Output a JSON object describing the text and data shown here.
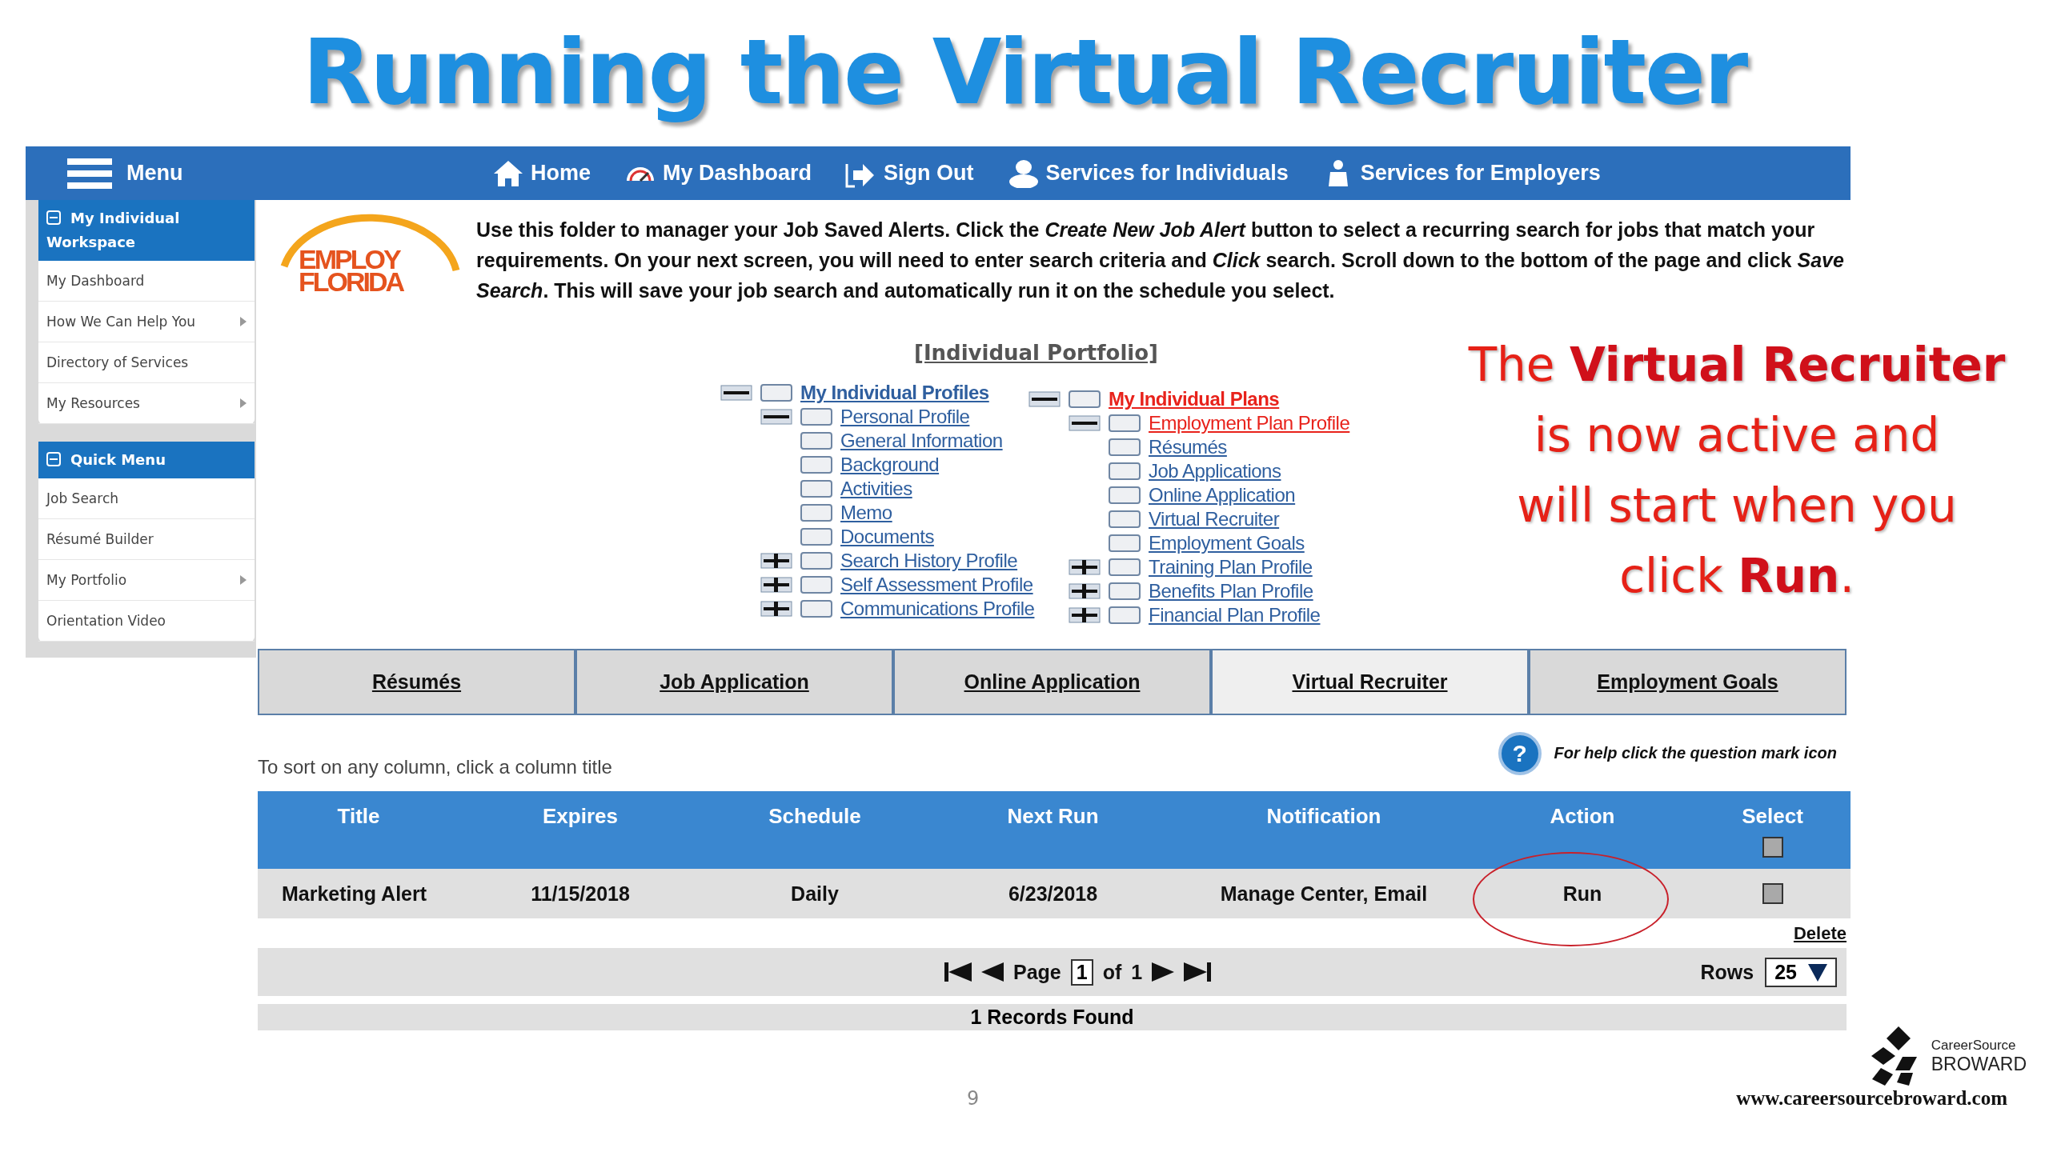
{
  "slide": {
    "title": "Running the Virtual Recruiter",
    "page_number": "9",
    "footer_url": "www.careersourcebroward.com",
    "brand": {
      "line_1": "CareerSource",
      "line_2": "BROWARD"
    }
  },
  "callout": {
    "lines": [
      "The **Virtual Recruiter**",
      "is now active and",
      "will start when you",
      "click **Run**."
    ]
  },
  "nav": {
    "menu_label": "Menu",
    "items": [
      {
        "label": "Home",
        "kind": "home"
      },
      {
        "label": "My Dashboard",
        "kind": "gauge"
      },
      {
        "label": "Sign Out",
        "kind": "signout"
      },
      {
        "label": "Services for Individuals",
        "kind": "individuals"
      },
      {
        "label": "Services for Employers",
        "kind": "employers"
      }
    ]
  },
  "sidebar": {
    "sections": [
      {
        "title": "My Individual Workspace",
        "expanded": true,
        "items": [
          {
            "label": "My Dashboard",
            "has_submenu": false
          },
          {
            "label": "How We Can Help You",
            "has_submenu": true
          },
          {
            "label": "Directory of Services",
            "has_submenu": false
          },
          {
            "label": "My Resources",
            "has_submenu": true
          }
        ]
      },
      {
        "title": "Quick Menu",
        "expanded": true,
        "items": [
          {
            "label": "Job Search",
            "has_submenu": false
          },
          {
            "label": "Résumé Builder",
            "has_submenu": false
          },
          {
            "label": "My Portfolio",
            "has_submenu": true
          },
          {
            "label": "Orientation Video",
            "has_submenu": false
          }
        ]
      }
    ]
  },
  "logo": {
    "line_1": "EMPLOY",
    "line_2": "FLORIDA"
  },
  "intro": "Use this folder to manager your Job Saved Alerts. Click the *Create New Job Alert* button to select a recurring search for jobs that match your requirements. On your next screen, you will need to enter search criteria and *Click* search. Scroll down to the bottom of the page and click *Save Search*. This will save your job search and automatically run it on the schedule you select.",
  "portfolio": {
    "title": "[Individual Portfolio]",
    "trees": [
      {
        "label": "My Individual Profiles",
        "selected": false,
        "expanded": true,
        "children": [
          {
            "label": "Personal Profile",
            "selected": false,
            "expanded": true,
            "children": [
              {
                "label": "General Information",
                "selected": false
              },
              {
                "label": "Background",
                "selected": false
              },
              {
                "label": "Activities",
                "selected": false
              },
              {
                "label": "Memo",
                "selected": false
              },
              {
                "label": "Documents",
                "selected": false
              }
            ]
          },
          {
            "label": "Search History Profile",
            "selected": false,
            "expanded": false
          },
          {
            "label": "Self Assessment Profile",
            "selected": false,
            "expanded": false
          },
          {
            "label": "Communications Profile",
            "selected": false,
            "expanded": false
          }
        ]
      },
      {
        "label": "My Individual Plans",
        "selected": true,
        "expanded": true,
        "children": [
          {
            "label": "Employment Plan Profile",
            "selected": true,
            "expanded": true,
            "children": [
              {
                "label": "Résumés",
                "selected": false
              },
              {
                "label": "Job Applications",
                "selected": false
              },
              {
                "label": "Online Application",
                "selected": false
              },
              {
                "label": "Virtual Recruiter",
                "selected": false
              },
              {
                "label": "Employment Goals",
                "selected": false
              }
            ]
          },
          {
            "label": "Training Plan Profile",
            "selected": false,
            "expanded": false
          },
          {
            "label": "Benefits Plan Profile",
            "selected": false,
            "expanded": false
          },
          {
            "label": "Financial Plan Profile",
            "selected": false,
            "expanded": false
          }
        ]
      }
    ]
  },
  "tabs": [
    {
      "label": "Résumés",
      "selected": false
    },
    {
      "label": "Job Application",
      "selected": false
    },
    {
      "label": "Online Application",
      "selected": false
    },
    {
      "label": "Virtual Recruiter",
      "selected": true
    },
    {
      "label": "Employment Goals",
      "selected": false
    }
  ],
  "sort_hint": "To sort on any column, click a column title",
  "help": {
    "icon": "?",
    "text": "For help click the question mark icon"
  },
  "table": {
    "columns": [
      "Title",
      "Expires",
      "Schedule",
      "Next Run",
      "Notification",
      "Action",
      "Select"
    ],
    "select_all_checked": false,
    "rows": [
      {
        "cells": [
          "Marketing Alert",
          "11/15/2018",
          "Daily",
          "6/23/2018",
          "Manage Center, Email"
        ],
        "action": "Run",
        "action_circled": true,
        "selected": false
      }
    ]
  },
  "delete_link": "Delete",
  "pager": {
    "page_label": "Page",
    "page": "1",
    "of_label": "of",
    "total": "1",
    "rows_label": "Rows",
    "rows_value": "25"
  },
  "records": "1 Records Found"
}
